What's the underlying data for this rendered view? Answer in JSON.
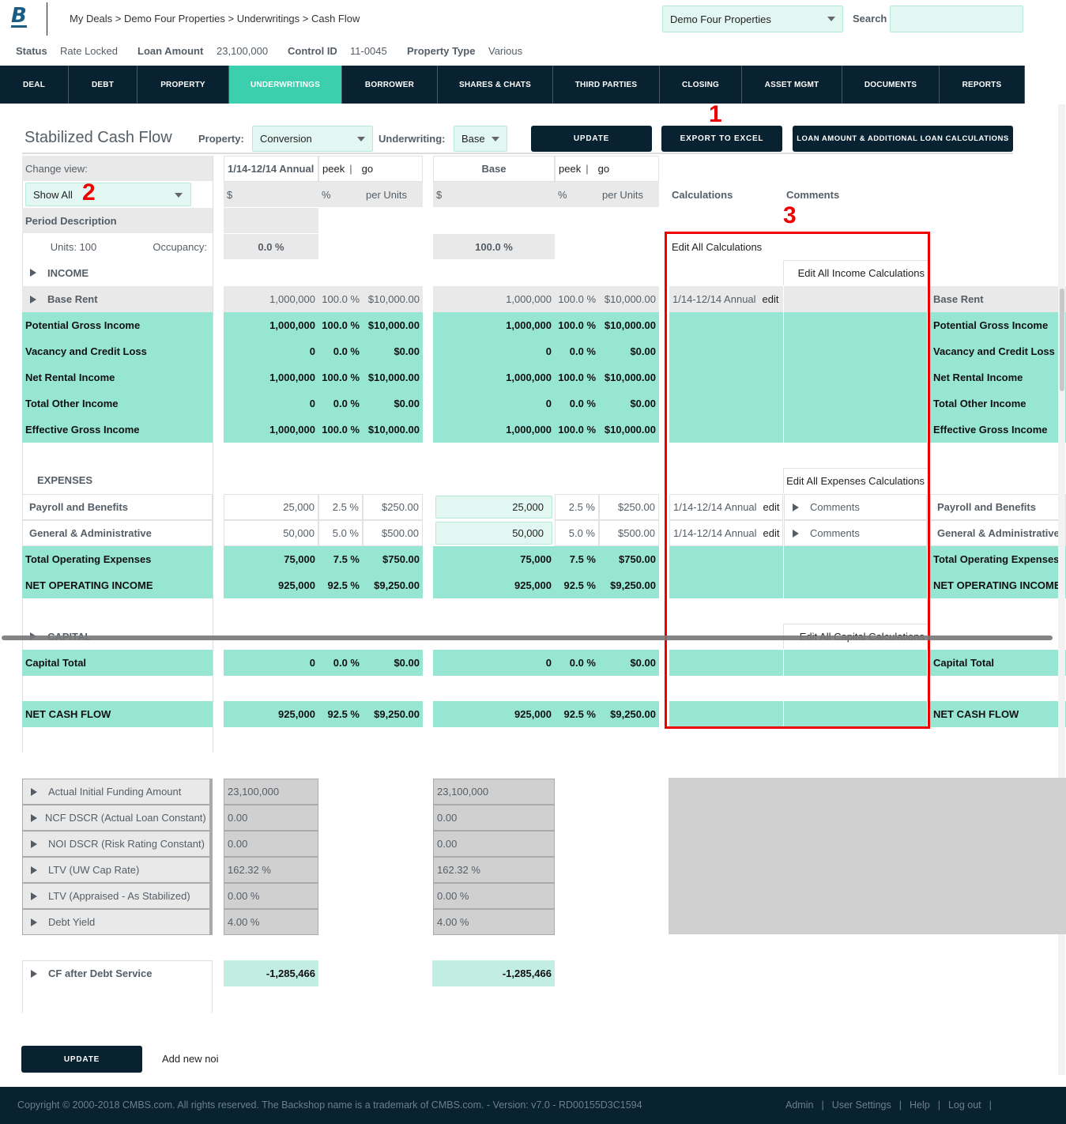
{
  "header": {
    "logo": "B",
    "breadcrumb": "My Deals > Demo Four Properties > Underwritings > Cash Flow",
    "deal_select": "Demo Four Properties",
    "search_label": "Search",
    "search_value": ""
  },
  "meta": {
    "status_label": "Status",
    "status": "Rate Locked",
    "loan_amount_label": "Loan Amount",
    "loan_amount": "23,100,000",
    "control_id_label": "Control ID",
    "control_id": "11-0045",
    "property_type_label": "Property Type",
    "property_type": "Various"
  },
  "nav": {
    "active": "UNDERWRITINGS",
    "tabs": [
      "DEAL",
      "DEBT",
      "PROPERTY",
      "UNDERWRITINGS",
      "BORROWER",
      "SHARES & CHATS",
      "THIRD PARTIES",
      "CLOSING",
      "ASSET MGMT",
      "DOCUMENTS",
      "REPORTS"
    ]
  },
  "toolbar": {
    "title": "Stabilized Cash Flow",
    "property_label": "Property:",
    "property_value": "Conversion",
    "underwriting_label": "Underwriting:",
    "underwriting_value": "Base",
    "update": "UPDATE",
    "export": "EXPORT TO EXCEL",
    "loan_calcs": "LOAN AMOUNT & ADDITIONAL LOAN CALCULATIONS"
  },
  "annotations": {
    "one": "1",
    "two": "2",
    "three": "3"
  },
  "grid": {
    "change_view_label": "Change view:",
    "view_select": "Show All",
    "period_description": "Period Description",
    "units": "Units: 100",
    "occupancy_label": "Occupancy:",
    "col_a": {
      "title": "1/14-12/14 Annual",
      "peek": "peek",
      "go": "go",
      "h_dollar": "$",
      "h_pct": "%",
      "h_per": "per Units",
      "occupancy": "0.0 %"
    },
    "col_b": {
      "title": "Base",
      "peek": "peek",
      "go": "go",
      "h_dollar": "$",
      "h_pct": "%",
      "h_per": "per Units",
      "occupancy": "100.0 %"
    },
    "calculations_label": "Calculations",
    "comments_label": "Comments",
    "edit_all": "Edit All Calculations",
    "edit_income": "Edit All Income Calculations",
    "edit_expenses": "Edit All Expenses Calculations",
    "edit_capital": "Edit All Capital Calculations",
    "income_section": "INCOME",
    "expenses_section": "EXPENSES",
    "capital_section": "CAPITAL"
  },
  "rows": [
    {
      "label": "Base Rent",
      "type": "line",
      "a": [
        "1,000,000",
        "100.0 %",
        "$10,000.00"
      ],
      "b": [
        "1,000,000",
        "100.0 %",
        "$10,000.00"
      ],
      "calc": "1/14-12/14 Annual",
      "edit": "edit",
      "comment": "",
      "right": "Base Rent"
    },
    {
      "label": "Potential Gross Income",
      "type": "total",
      "a": [
        "1,000,000",
        "100.0 %",
        "$10,000.00"
      ],
      "b": [
        "1,000,000",
        "100.0 %",
        "$10,000.00"
      ],
      "right": "Potential Gross Income"
    },
    {
      "label": "Vacancy and Credit Loss",
      "type": "total",
      "a": [
        "0",
        "0.0 %",
        "$0.00"
      ],
      "b": [
        "0",
        "0.0 %",
        "$0.00"
      ],
      "right": "Vacancy and Credit Loss"
    },
    {
      "label": "Net Rental Income",
      "type": "total",
      "a": [
        "1,000,000",
        "100.0 %",
        "$10,000.00"
      ],
      "b": [
        "1,000,000",
        "100.0 %",
        "$10,000.00"
      ],
      "right": "Net Rental Income"
    },
    {
      "label": "Total Other Income",
      "type": "total",
      "a": [
        "0",
        "0.0 %",
        "$0.00"
      ],
      "b": [
        "0",
        "0.0 %",
        "$0.00"
      ],
      "right": "Total Other Income"
    },
    {
      "label": "Effective Gross Income",
      "type": "total",
      "a": [
        "1,000,000",
        "100.0 %",
        "$10,000.00"
      ],
      "b": [
        "1,000,000",
        "100.0 %",
        "$10,000.00"
      ],
      "right": "Effective Gross Income"
    },
    {
      "label": "Payroll and Benefits",
      "type": "input",
      "a": [
        "25,000",
        "2.5 %",
        "$250.00"
      ],
      "b": [
        "25,000",
        "2.5 %",
        "$250.00"
      ],
      "calc": "1/14-12/14 Annual",
      "edit": "edit",
      "comment": "Comments",
      "right": "Payroll and Benefits"
    },
    {
      "label": "General & Administrative",
      "type": "input",
      "a": [
        "50,000",
        "5.0 %",
        "$500.00"
      ],
      "b": [
        "50,000",
        "5.0 %",
        "$500.00"
      ],
      "calc": "1/14-12/14 Annual",
      "edit": "edit",
      "comment": "Comments",
      "right": "General & Administrative"
    },
    {
      "label": "Total Operating Expenses",
      "type": "total",
      "a": [
        "75,000",
        "7.5 %",
        "$750.00"
      ],
      "b": [
        "75,000",
        "7.5 %",
        "$750.00"
      ],
      "right": "Total Operating Expenses"
    },
    {
      "label": "NET OPERATING INCOME",
      "type": "total",
      "a": [
        "925,000",
        "92.5 %",
        "$9,250.00"
      ],
      "b": [
        "925,000",
        "92.5 %",
        "$9,250.00"
      ],
      "right": "NET OPERATING INCOME"
    },
    {
      "label": "Capital Total",
      "type": "total",
      "a": [
        "0",
        "0.0 %",
        "$0.00"
      ],
      "b": [
        "0",
        "0.0 %",
        "$0.00"
      ],
      "right": "Capital Total"
    },
    {
      "label": "NET CASH FLOW",
      "type": "total",
      "a": [
        "925,000",
        "92.5 %",
        "$9,250.00"
      ],
      "b": [
        "925,000",
        "92.5 %",
        "$9,250.00"
      ],
      "right": "NET CASH FLOW"
    }
  ],
  "metrics": [
    {
      "label": "Actual Initial Funding Amount",
      "a": "23,100,000",
      "b": "23,100,000"
    },
    {
      "label": "NCF DSCR (Actual Loan Constant)",
      "a": "0.00",
      "b": "0.00"
    },
    {
      "label": "NOI DSCR (Risk Rating Constant)",
      "a": "0.00",
      "b": "0.00"
    },
    {
      "label": "LTV (UW Cap Rate)",
      "a": "162.32 %",
      "b": "162.32 %"
    },
    {
      "label": "LTV (Appraised - As Stabilized)",
      "a": "0.00 %",
      "b": "0.00 %"
    },
    {
      "label": "Debt Yield",
      "a": "4.00 %",
      "b": "4.00 %"
    }
  ],
  "cf_after_debt": {
    "label": "CF after Debt Service",
    "a": "-1,285,466",
    "b": "-1,285,466"
  },
  "bottom": {
    "update": "UPDATE",
    "add_noi": "Add new noi"
  },
  "footer": {
    "copyright": "Copyright © 2000-2018 CMBS.com. All rights reserved. The Backshop name is a trademark of CMBS.com. - Version: v7.0 - RD00155D3C1594",
    "links": [
      "Admin",
      "User Settings",
      "Help",
      "Log out"
    ]
  },
  "colors": {
    "navy": "#082231",
    "teal_active": "#3ccfae",
    "teal_row": "#97e6d4",
    "annotation_red": "#e00000"
  }
}
